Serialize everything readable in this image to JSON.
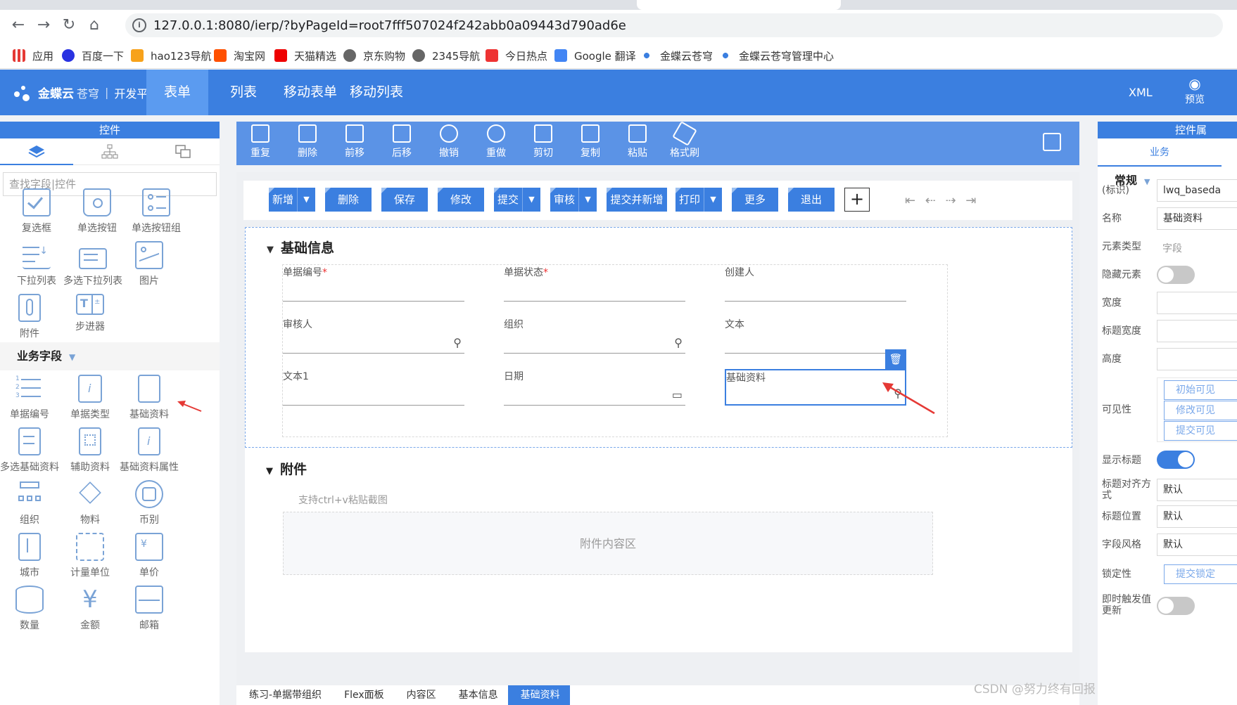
{
  "browser": {
    "url": "127.0.0.1:8080/ierp/?byPageId=root7fff507024f242abb0a09443d790ad6e",
    "bookmarks": [
      "应用",
      "百度一下",
      "hao123导航",
      "淘宝网",
      "天猫精选",
      "京东购物",
      "2345导航",
      "今日热点",
      "Google 翻译",
      "金蝶云苍穹",
      "金蝶云苍穹管理中心"
    ]
  },
  "header": {
    "brand": "金蝶云",
    "brand2": "苍穹",
    "platform": "开发平台",
    "tabs": [
      "表单",
      "列表",
      "移动表单",
      "移动列表"
    ],
    "xml": "XML",
    "preview": "预览"
  },
  "left": {
    "title": "控件",
    "search_placeholder": "查找字段|控件",
    "controls": [
      "复选框",
      "单选按钮",
      "单选按钮组",
      "下拉列表",
      "多选下拉列表",
      "图片",
      "附件",
      "步进器"
    ],
    "biz_section": "业务字段",
    "biz_fields": [
      "单据编号",
      "单据类型",
      "基础资料",
      "多选基础资料",
      "辅助资料",
      "基础资料属性",
      "组织",
      "物料",
      "币别",
      "城市",
      "计量单位",
      "单价",
      "数量",
      "金额",
      "邮箱"
    ]
  },
  "toolbar": {
    "items": [
      "重复",
      "删除",
      "前移",
      "后移",
      "撤销",
      "重做",
      "剪切",
      "复制",
      "粘贴",
      "格式刷"
    ]
  },
  "form": {
    "buttons": [
      "新增",
      "删除",
      "保存",
      "修改",
      "提交",
      "审核",
      "提交并新增",
      "打印",
      "更多",
      "退出"
    ],
    "plus": "+",
    "pager": "⇤ ⇠ ⇢ ⇥",
    "group_title": "基础信息",
    "fields": [
      {
        "label": "单据编号",
        "required": "*"
      },
      {
        "label": "单据状态",
        "required": "*"
      },
      {
        "label": "创建人",
        "required": ""
      },
      {
        "label": "审核人",
        "required": ""
      },
      {
        "label": "组织",
        "required": ""
      },
      {
        "label": "文本",
        "required": ""
      },
      {
        "label": "文本1",
        "required": ""
      },
      {
        "label": "日期",
        "required": ""
      },
      {
        "label": "基础资料",
        "required": ""
      }
    ],
    "attach_title": "附件",
    "attach_hint": "支持ctrl+v粘贴截图",
    "attach_zone": "附件内容区",
    "breadcrumb": [
      "练习-单据带组织",
      "Flex面板",
      "内容区",
      "基本信息",
      "基础资料"
    ]
  },
  "right": {
    "title": "控件属",
    "tab": "业务",
    "section": "常规",
    "props": {
      "id_label": "(标识)",
      "id_value": "lwq_baseda",
      "name_label": "名称",
      "name_value": "基础资料",
      "type_label": "元素类型",
      "type_value": "字段",
      "hidden_label": "隐藏元素",
      "width_label": "宽度",
      "title_width_label": "标题宽度",
      "height_label": "高度",
      "visible_label": "可见性",
      "vis_init": "初始可见",
      "vis_edit": "修改可见",
      "vis_submit": "提交可见",
      "show_title_label": "显示标题",
      "title_align_label": "标题对齐方式",
      "title_align_value": "默认",
      "title_pos_label": "标题位置",
      "title_pos_value": "默认",
      "field_style_label": "字段风格",
      "field_style_value": "默认",
      "lock_label": "锁定性",
      "lock_value": "提交锁定",
      "instant_label": "即时触发值更新"
    }
  },
  "watermark": "CSDN @努力终有回报",
  "colors": {
    "primary": "#3b7fe0",
    "toolbar": "#5b93e6"
  }
}
